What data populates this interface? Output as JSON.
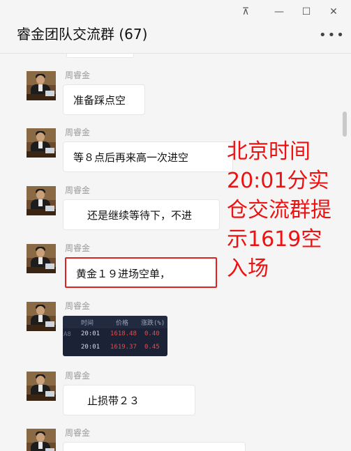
{
  "window": {
    "title": "睿金团队交流群 (67)",
    "pin_glyph": "⊼",
    "minimize_glyph": "—",
    "maximize_glyph": "☐",
    "close_glyph": "✕",
    "more_glyph": "•••"
  },
  "messages": [
    {
      "sender": "周睿金",
      "text": "准备踩点空"
    },
    {
      "sender": "周睿金",
      "text": "等８点后再来高一次进空"
    },
    {
      "sender": "周睿金",
      "text": "还是继续等待下，不进"
    },
    {
      "sender": "周睿金",
      "text": "黄金１９进场空单，",
      "highlighted": true
    },
    {
      "sender": "周睿金",
      "image": {
        "header": [
          "时间",
          "价格",
          "涨跌(%)"
        ],
        "side_label": "A8",
        "rows": [
          [
            "20:01",
            "1618.48",
            "0.40"
          ],
          [
            "20:01",
            "1619.37",
            "0.45"
          ]
        ]
      }
    },
    {
      "sender": "周睿金",
      "text": "止损带２３"
    },
    {
      "sender": "周睿金",
      "text": ""
    }
  ],
  "annotation": {
    "lines": [
      "北京时间",
      "20:01分实",
      "仓交流群提",
      "示1619空",
      "入场"
    ],
    "color": "#ee1111"
  },
  "colors": {
    "highlight_border": "#e32020",
    "quote_bg": "#1b2236",
    "quote_red": "#e84b4b"
  }
}
